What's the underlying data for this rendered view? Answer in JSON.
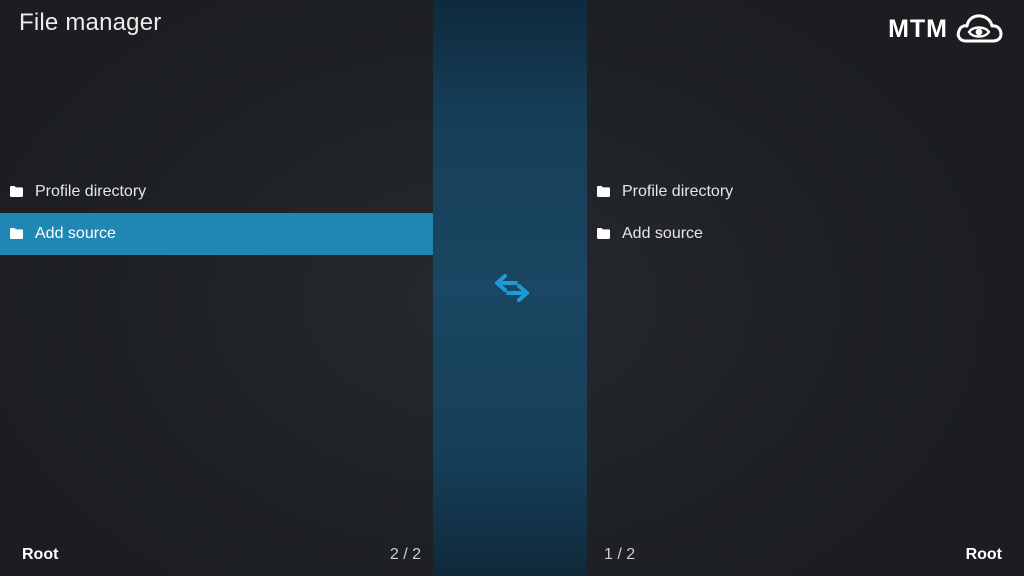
{
  "header": {
    "title": "File manager",
    "logo_text": "MTM",
    "logo_icon": "cloud-eye-icon"
  },
  "left_pane": {
    "items": [
      {
        "label": "Profile directory",
        "icon": "folder-icon",
        "selected": false
      },
      {
        "label": "Add source",
        "icon": "folder-icon",
        "selected": true
      }
    ],
    "path": "Root",
    "count": "2 / 2"
  },
  "center": {
    "icon": "swap-arrows-icon",
    "accent_color": "#1f87b3"
  },
  "right_pane": {
    "items": [
      {
        "label": "Profile directory",
        "icon": "folder-icon",
        "selected": false
      },
      {
        "label": "Add source",
        "icon": "folder-icon",
        "selected": false
      }
    ],
    "path": "Root",
    "count": "1 / 2"
  },
  "colors": {
    "background": "#1e2124",
    "selection": "#1f87b3",
    "center_strip": "#1a4763"
  }
}
